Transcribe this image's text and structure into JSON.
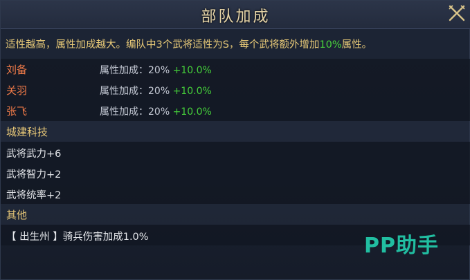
{
  "window": {
    "title": "部队加成",
    "close_icon": "close-icon-crossed-swords"
  },
  "description": {
    "prefix": "适性越高，属性加成越大。编队中3个武将适性为S，每个武将额外增加",
    "highlight": "10%",
    "suffix": "属性。"
  },
  "generals": [
    {
      "name": "刘备",
      "attr_label": "属性加成：",
      "base": "20%",
      "bonus": "+10.0%"
    },
    {
      "name": "关羽",
      "attr_label": "属性加成：",
      "base": "20%",
      "bonus": "+10.0%"
    },
    {
      "name": "张飞",
      "attr_label": "属性加成：",
      "base": "20%",
      "bonus": "+10.0%"
    }
  ],
  "tech": {
    "title": "城建科技",
    "items": [
      "武将武力+6",
      "武将智力+2",
      "武将统率+2"
    ]
  },
  "other": {
    "title": "其他",
    "items": [
      "【 出生州 】骑兵伤害加成1.0%"
    ]
  },
  "watermark": "PP助手",
  "colors": {
    "title": "#e8d6a8",
    "description": "#e6c877",
    "general_name": "#f07a48",
    "bonus_green": "#45d03a",
    "section_title": "#e8c878",
    "watermark": "#22c7a8"
  }
}
